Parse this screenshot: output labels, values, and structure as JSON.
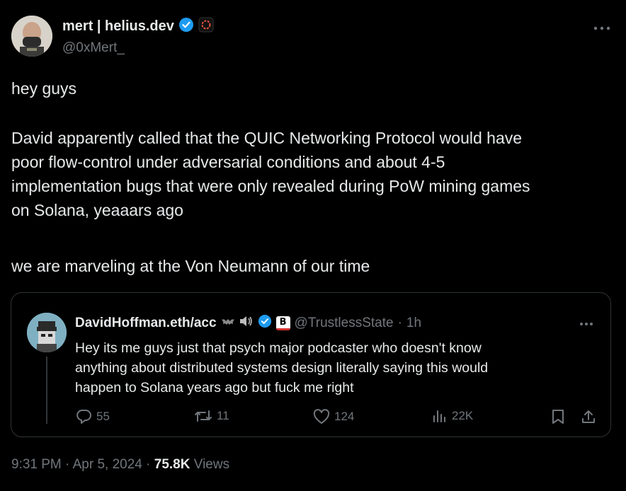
{
  "author": {
    "name": "mert | helius.dev",
    "handle": "@0xMert_"
  },
  "tweet": {
    "line1": "hey guys",
    "para2": [
      "David apparently called that the QUIC Networking Protocol would have",
      "poor flow-control under adversarial conditions and about 4-5",
      "implementation bugs that were only revealed during PoW mining games",
      "on Solana, yeaaars ago"
    ],
    "para3": "we are marveling at the Von Neumann of our time"
  },
  "quote": {
    "name": "DavidHoffman.eth/acc",
    "badge_letter": "B",
    "handle": "@TrustlessState",
    "dot": "·",
    "time": "1h",
    "text": [
      "Hey its me guys just that psych major podcaster who doesn't know",
      "anything about distributed systems design literally saying this would",
      "happen to Solana years ago but fuck me right"
    ],
    "replies": "55",
    "reposts": "11",
    "likes": "124",
    "views": "22K"
  },
  "meta": {
    "time": "9:31 PM",
    "dot1": "·",
    "date": "Apr 5, 2024",
    "dot2": "·",
    "views_count": "75.8K",
    "views_label": "Views"
  },
  "colors": {
    "background": "#000000",
    "text": "#e7e9ea",
    "muted": "#71767b",
    "verified": "#1d9bf0",
    "border": "#2f3336"
  },
  "icons": [
    "verified-badge-icon",
    "affiliate-badge-icon",
    "more-icon",
    "reply-icon",
    "repost-icon",
    "like-icon",
    "views-icon",
    "bookmark-icon",
    "share-icon"
  ]
}
